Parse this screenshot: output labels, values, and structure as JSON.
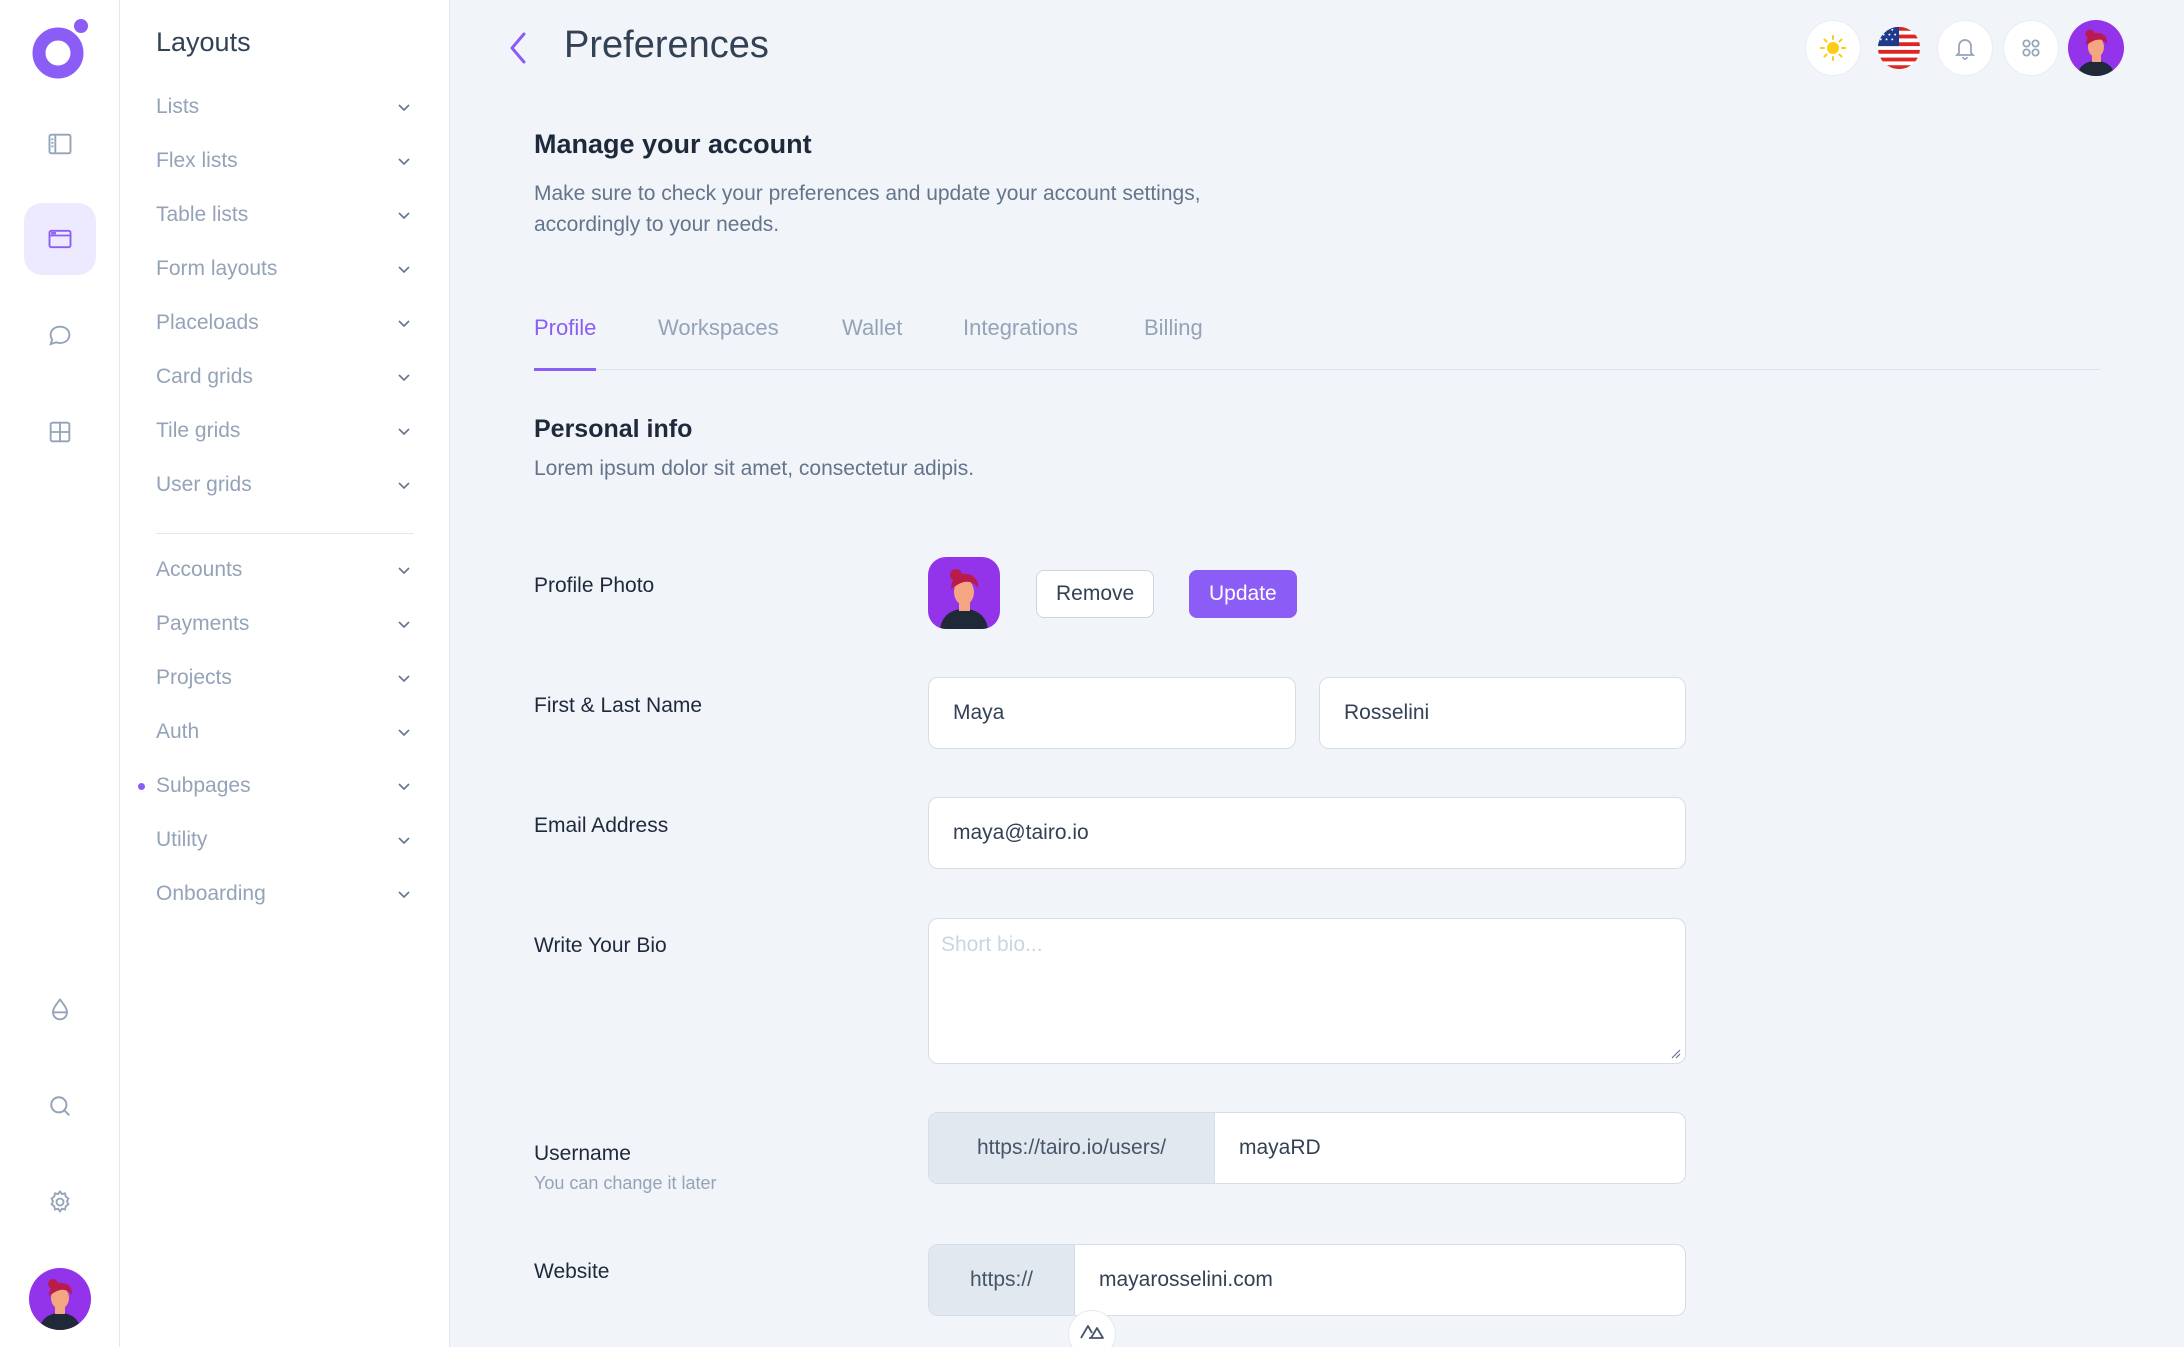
{
  "submenu": {
    "title": "Layouts",
    "items": [
      {
        "label": "Lists"
      },
      {
        "label": "Flex lists"
      },
      {
        "label": "Table lists"
      },
      {
        "label": "Form layouts"
      },
      {
        "label": "Placeloads"
      },
      {
        "label": "Card grids"
      },
      {
        "label": "Tile grids"
      },
      {
        "label": "User grids"
      },
      {
        "label": "Accounts"
      },
      {
        "label": "Payments"
      },
      {
        "label": "Projects"
      },
      {
        "label": "Auth"
      },
      {
        "label": "Subpages"
      },
      {
        "label": "Utility"
      },
      {
        "label": "Onboarding"
      }
    ]
  },
  "header": {
    "title": "Preferences"
  },
  "account": {
    "title": "Manage your account",
    "description": "Make sure to check your preferences and update your account settings, accordingly to your needs."
  },
  "tabs": [
    {
      "label": "Profile",
      "active": true
    },
    {
      "label": "Workspaces",
      "active": false
    },
    {
      "label": "Wallet",
      "active": false
    },
    {
      "label": "Integrations",
      "active": false
    },
    {
      "label": "Billing",
      "active": false
    }
  ],
  "personal": {
    "title": "Personal info",
    "description": "Lorem ipsum dolor sit amet, consectetur adipis."
  },
  "form": {
    "photo_label": "Profile Photo",
    "remove_label": "Remove",
    "update_label": "Update",
    "name_label": "First & Last Name",
    "first_name": "Maya",
    "last_name": "Rosselini",
    "email_label": "Email Address",
    "email": "maya@tairo.io",
    "bio_label": "Write Your Bio",
    "bio_placeholder": "Short bio...",
    "username_label": "Username",
    "username_hint": "You can change it later",
    "username_prefix": "https://tairo.io/users/",
    "username": "mayaRD",
    "website_label": "Website",
    "website_prefix": "https://",
    "website": "mayarosselini.com"
  },
  "colors": {
    "primary": "#8b5cf6",
    "background": "#f1f5f9",
    "muted_text": "#94a3b8"
  },
  "icons": {
    "rail": [
      "sidebar-icon",
      "layout-icon",
      "chat-bubble-icon",
      "grid-icon",
      "drop-icon",
      "search-icon",
      "gear-icon"
    ],
    "topbar": [
      "sun-icon",
      "us-flag-icon",
      "bell-icon",
      "apps-grid-icon"
    ]
  }
}
